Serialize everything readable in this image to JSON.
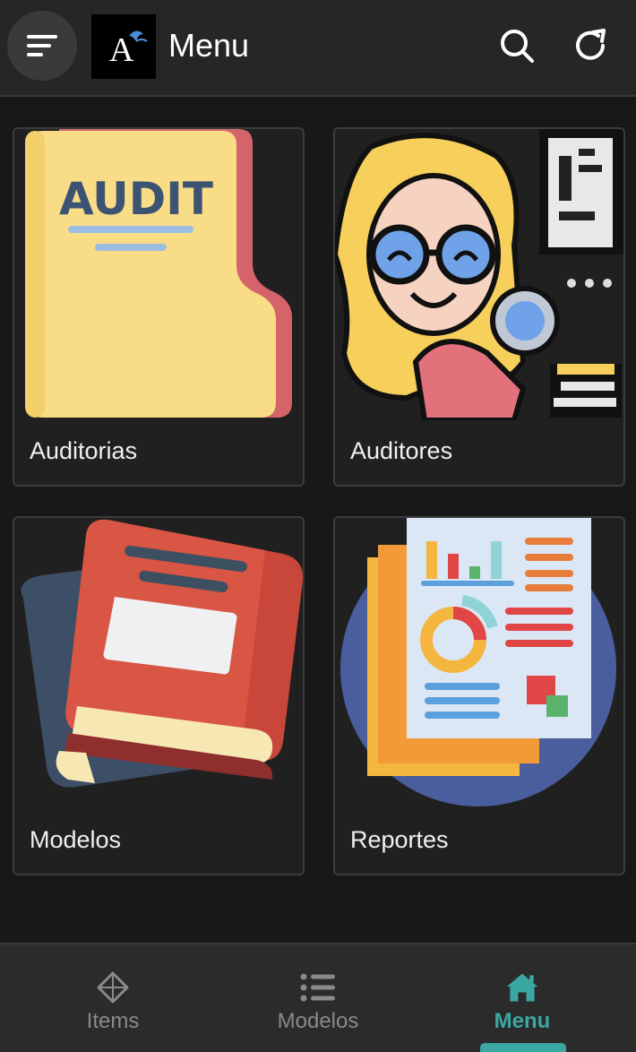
{
  "header": {
    "title": "Menu",
    "logo_text": "A",
    "icons": {
      "menu": "hamburger-icon",
      "search": "search-icon",
      "refresh": "refresh-icon"
    }
  },
  "cards": [
    {
      "label": "Auditorias",
      "icon": "audit-folder-illustration",
      "image_text": "AUDIT"
    },
    {
      "label": "Auditores",
      "icon": "auditor-with-magnifier-illustration"
    },
    {
      "label": "Modelos",
      "icon": "books-illustration"
    },
    {
      "label": "Reportes",
      "icon": "report-charts-illustration"
    }
  ],
  "tabbar": {
    "items": [
      {
        "label": "Items",
        "icon": "diamond-icon",
        "active": false
      },
      {
        "label": "Modelos",
        "icon": "list-icon",
        "active": false
      },
      {
        "label": "Menu",
        "icon": "home-icon",
        "active": true
      }
    ],
    "accent_color": "#3aa7a3",
    "inactive_color": "#8a8a8a"
  }
}
